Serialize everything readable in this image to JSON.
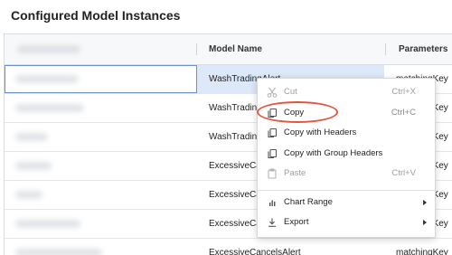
{
  "page": {
    "title": "Configured Model Instances"
  },
  "table": {
    "columns": [
      "Model Name",
      "Parameters"
    ],
    "rows": [
      {
        "model": "WashTradingAlert",
        "params": "matchingKey"
      },
      {
        "model": "WashTradingAlert",
        "params": "matchingKey"
      },
      {
        "model": "WashTradingAlert",
        "params": "matchingKey"
      },
      {
        "model": "ExcessiveCancelsAlert",
        "params": "matchingKey"
      },
      {
        "model": "ExcessiveCancelsAlert",
        "params": "matchingKey"
      },
      {
        "model": "ExcessiveCancelsAlert",
        "params": "matchingKey"
      },
      {
        "model": "ExcessiveCancelsAlert",
        "params": "matchingKey"
      }
    ]
  },
  "context_menu": {
    "items": [
      {
        "label": "Cut",
        "shortcut": "Ctrl+X",
        "icon": "scissors-icon",
        "disabled": true
      },
      {
        "label": "Copy",
        "shortcut": "Ctrl+C",
        "icon": "copy-icon",
        "disabled": false
      },
      {
        "label": "Copy with Headers",
        "shortcut": "",
        "icon": "copy-icon",
        "disabled": false
      },
      {
        "label": "Copy with Group Headers",
        "shortcut": "",
        "icon": "copy-icon",
        "disabled": false
      },
      {
        "label": "Paste",
        "shortcut": "Ctrl+V",
        "icon": "paste-icon",
        "disabled": true
      },
      {
        "label": "Chart Range",
        "shortcut": "",
        "icon": "bar-chart-icon",
        "disabled": false,
        "submenu": true
      },
      {
        "label": "Export",
        "shortcut": "",
        "icon": "download-icon",
        "disabled": false,
        "submenu": true
      }
    ]
  },
  "annotation": {
    "highlight_color": "#e0573e",
    "target": "Copy"
  },
  "colors": {
    "selected_row": "#dde8f8",
    "header_bg": "#f7f8f9"
  }
}
